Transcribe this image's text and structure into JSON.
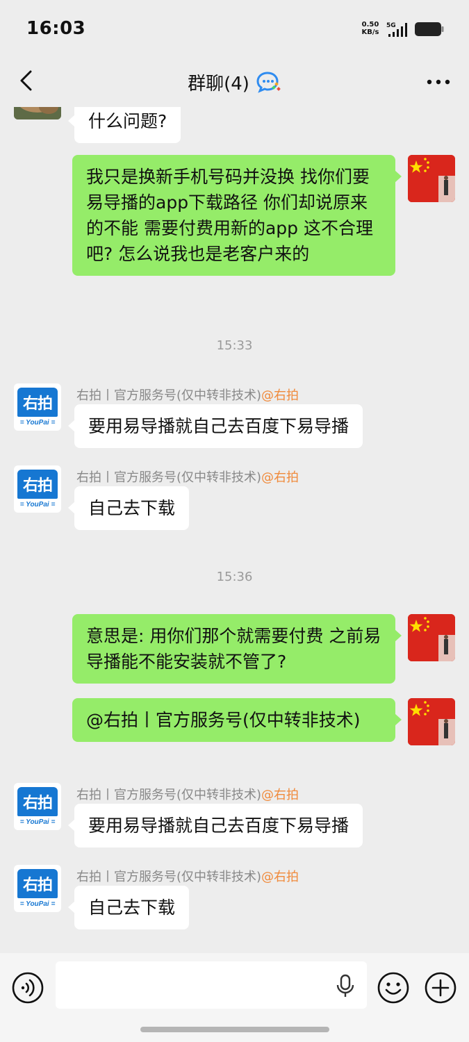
{
  "status_bar": {
    "time": "16:03",
    "net_speed_value": "0.50",
    "net_speed_unit": "KB/s",
    "network": "5G"
  },
  "header": {
    "title": "群聊(4)"
  },
  "messages": [
    {
      "side": "left",
      "avatar": "photo-avatar",
      "text": "什么问题?"
    },
    {
      "side": "right",
      "avatar": "flag-avatar",
      "text": "我只是换新手机号码并没换 找你们要易导播的app下载路径 你们却说原来的不能 需要付费用新的app 这不合理吧? 怎么说我也是老客户来的"
    },
    {
      "type": "time",
      "text": "15:33"
    },
    {
      "side": "left",
      "avatar": "youpai-avatar",
      "sender": "右拍丨官方服务号(仅中转非技术)",
      "mention": "@右拍",
      "text": "要用易导播就自己去百度下易导播"
    },
    {
      "side": "left",
      "avatar": "youpai-avatar",
      "sender": "右拍丨官方服务号(仅中转非技术)",
      "mention": "@右拍",
      "text": "自己去下载"
    },
    {
      "type": "time",
      "text": "15:36"
    },
    {
      "side": "right",
      "avatar": "flag-avatar",
      "text": "意思是: 用你们那个就需要付费 之前易导播能不能安装就不管了?"
    },
    {
      "side": "right",
      "avatar": "flag-avatar",
      "text": "@右拍丨官方服务号(仅中转非技术)"
    },
    {
      "side": "left",
      "avatar": "youpai-avatar",
      "sender": "右拍丨官方服务号(仅中转非技术)",
      "mention": "@右拍",
      "text": "要用易导播就自己去百度下易导播"
    },
    {
      "side": "left",
      "avatar": "youpai-avatar",
      "sender": "右拍丨官方服务号(仅中转非技术)",
      "mention": "@右拍",
      "text": "自己去下载"
    }
  ],
  "youpai_logo": {
    "top": "右拍",
    "bottom": "= YouPai ="
  },
  "input": {
    "value": "",
    "placeholder": ""
  },
  "icons": {
    "back": "chevron-left-icon",
    "title_badge": "chat-bubble-icon",
    "more": "more-dots-icon",
    "voice": "voice-icon",
    "mic": "microphone-icon",
    "emoji": "emoji-icon",
    "plus": "plus-icon"
  },
  "colors": {
    "background": "#ededed",
    "bubble_right": "#95ec69",
    "bubble_left": "#ffffff",
    "mention": "#f08a3b",
    "youpai_blue": "#1677d2"
  }
}
